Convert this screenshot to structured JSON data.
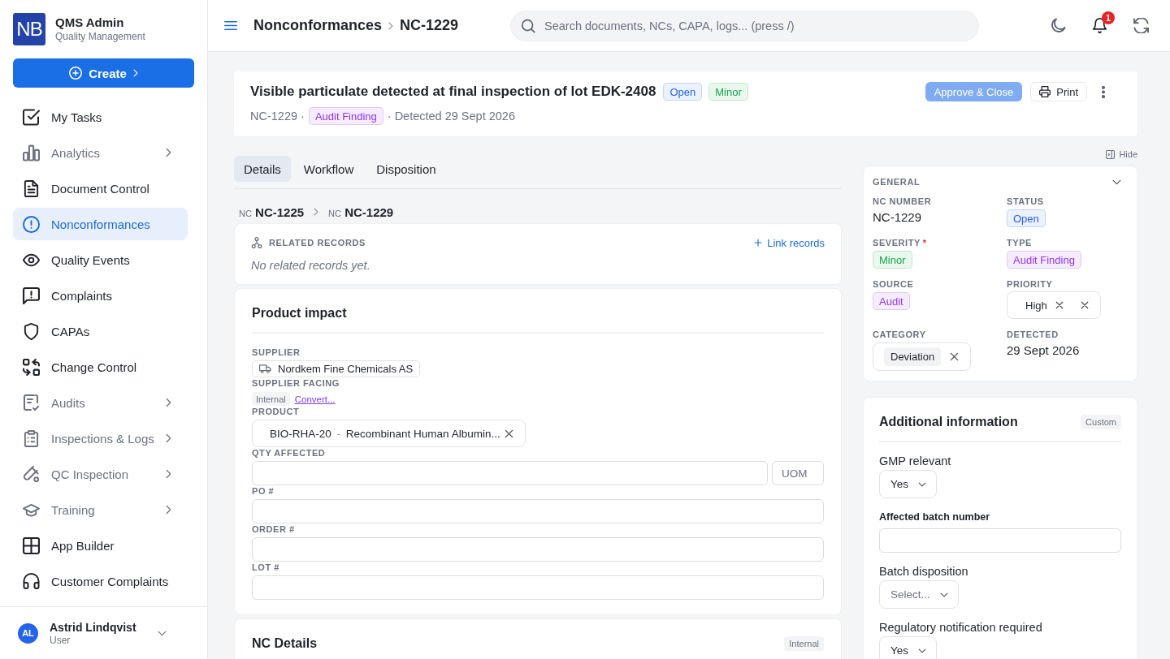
{
  "sidebar": {
    "logo": "NB",
    "title": "QMS Admin",
    "subtitle": "Quality Management",
    "create_button": "Create",
    "items": [
      {
        "label": "My Tasks",
        "kind": "link",
        "selected": false
      },
      {
        "label": "Analytics",
        "kind": "group",
        "selected": false
      },
      {
        "label": "Document Control",
        "kind": "link",
        "selected": false
      },
      {
        "label": "Nonconformances",
        "kind": "link",
        "selected": true
      },
      {
        "label": "Quality Events",
        "kind": "link",
        "selected": false
      },
      {
        "label": "Complaints",
        "kind": "link",
        "selected": false
      },
      {
        "label": "CAPAs",
        "kind": "link",
        "selected": false
      },
      {
        "label": "Change Control",
        "kind": "link",
        "selected": false
      },
      {
        "label": "Audits",
        "kind": "group",
        "selected": false
      },
      {
        "label": "Inspections & Logs",
        "kind": "group",
        "selected": false
      },
      {
        "label": "QC Inspection",
        "kind": "group",
        "selected": false
      },
      {
        "label": "Training",
        "kind": "group",
        "selected": false
      },
      {
        "label": "App Builder",
        "kind": "link",
        "selected": false
      },
      {
        "label": "Customer Complaints",
        "kind": "link",
        "selected": false
      }
    ],
    "user": {
      "initials": "AL",
      "name": "Astrid Lindqvist",
      "role": "User"
    }
  },
  "topbar": {
    "breadcrumb": [
      "Nonconformances",
      "NC-1229"
    ],
    "search": {
      "placeholder": "Search documents, NCs, CAPA, logs... (press /)"
    },
    "notifications": "1"
  },
  "header": {
    "title": "Visible particulate detected at final inspection of lot EDK-2408",
    "badges": [
      {
        "label": "Open",
        "color": "#2563eb"
      },
      {
        "label": "Minor",
        "color": "#16a34a"
      }
    ],
    "record_id": "NC-1229 ·",
    "type_badge": {
      "label": "Audit Finding",
      "color": "#9333ea"
    },
    "detected": "· Detected 29 Sept 2026",
    "approve_button": {
      "label": "Approve & Close",
      "disabled": true
    },
    "print_button": "Print"
  },
  "hide_link": "Hide",
  "tabs": [
    {
      "label": "Details",
      "selected": true
    },
    {
      "label": "Workflow",
      "selected": false
    },
    {
      "label": "Disposition",
      "selected": false
    }
  ],
  "record_trail": [
    {
      "prefix": "NC",
      "id": "NC-1225"
    },
    {
      "prefix": "NC",
      "id": "NC-1229"
    }
  ],
  "related_records": {
    "title": "RELATED RECORDS",
    "action": "Link records",
    "empty": "No related records yet."
  },
  "product_impact": {
    "title": "Product impact",
    "fields": [
      {
        "kind": "chip",
        "label": "SUPPLIER",
        "value": "Nordkem Fine Chemicals AS"
      },
      {
        "kind": "facing",
        "label": "SUPPLIER FACING",
        "tag": "Internal",
        "link": "Convert..."
      },
      {
        "kind": "product",
        "label": "PRODUCT",
        "code": "BIO-RHA-20",
        "separator": "-",
        "name": "Recombinant Human Albumin..."
      },
      {
        "kind": "quantity",
        "label": "QTY AFFECTED",
        "unit_placeholder": "UOM"
      },
      {
        "kind": "input",
        "label": "PO #"
      },
      {
        "kind": "input",
        "label": "ORDER #"
      },
      {
        "kind": "input",
        "label": "LOT #"
      }
    ]
  },
  "nc_details": {
    "title": "NC Details",
    "tag": "Internal"
  },
  "general": {
    "title": "GENERAL",
    "fields": [
      {
        "kind": "text",
        "label": "NC NUMBER",
        "value": "NC-1229"
      },
      {
        "kind": "badge",
        "label": "STATUS",
        "value": "Open",
        "color": "#2563eb"
      },
      {
        "kind": "badge",
        "label": "SEVERITY",
        "required_mark": "*",
        "value": "Minor",
        "color": "#16a34a"
      },
      {
        "kind": "badge",
        "label": "TYPE",
        "value": "Audit Finding",
        "color": "#9333ea"
      },
      {
        "kind": "badge",
        "label": "SOURCE",
        "value": "Audit",
        "color": "#9333ea"
      },
      {
        "kind": "select",
        "label": "PRIORITY",
        "value": "High"
      },
      {
        "kind": "chips",
        "label": "CATEGORY",
        "value": "Deviation"
      },
      {
        "kind": "text",
        "label": "DETECTED",
        "value": "29 Sept 2026"
      }
    ]
  },
  "additional_info": {
    "title": "Additional information",
    "tag": "Custom",
    "fields": [
      {
        "kind": "select",
        "label": "GMP relevant",
        "value": "Yes"
      },
      {
        "kind": "input",
        "label": "Affected batch number"
      },
      {
        "kind": "select",
        "label": "Batch disposition",
        "placeholder": "Select..."
      },
      {
        "kind": "select",
        "label": "Regulatory notification required",
        "value": "Yes"
      }
    ]
  }
}
